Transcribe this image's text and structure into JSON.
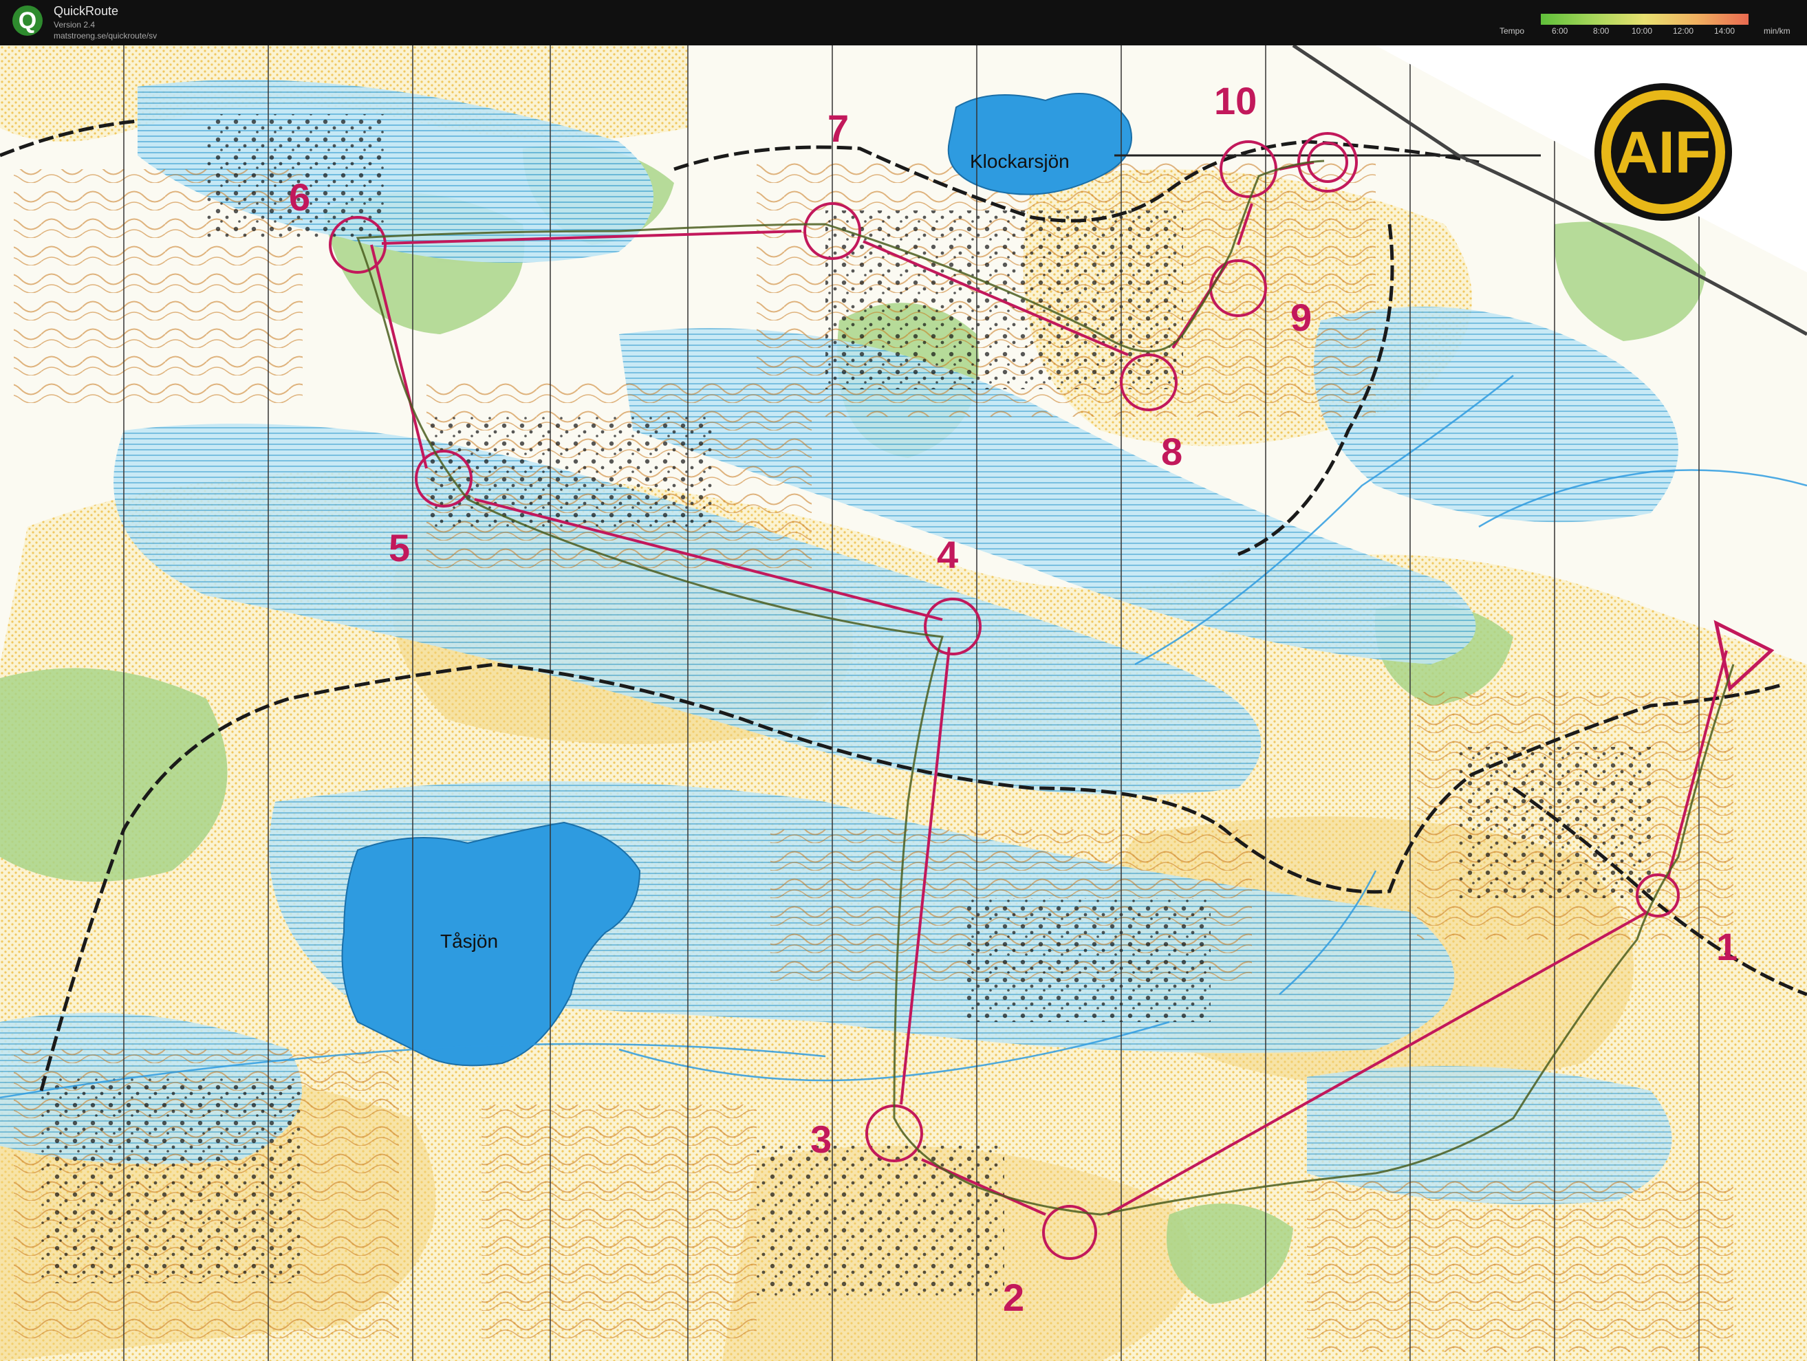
{
  "app": {
    "title": "QuickRoute",
    "version": "Version 2.4",
    "url": "matstroeng.se/quickroute/sv",
    "logo_letter": "Q"
  },
  "tempo_legend": {
    "label": "Tempo",
    "ticks": [
      "6:00",
      "8:00",
      "10:00",
      "12:00",
      "14:00"
    ],
    "unit": "min/km",
    "colors": [
      "#5fbf3a",
      "#a6d65a",
      "#e8e070",
      "#f0b060",
      "#e86a50"
    ]
  },
  "map": {
    "club_logo_text": "AIF",
    "lakes": [
      "Klockarsjön",
      "Tåsjön"
    ],
    "controls": [
      "1",
      "2",
      "3",
      "4",
      "5",
      "6",
      "7",
      "8",
      "9",
      "10"
    ],
    "course_color": "#c2185b",
    "colors": {
      "water": "#2e9be0",
      "marsh": "#a9dcf0",
      "open_land": "#f3d37a",
      "forest_green": "#a9d58a",
      "contour": "#c8781e",
      "track": "#1a1a1a"
    }
  }
}
